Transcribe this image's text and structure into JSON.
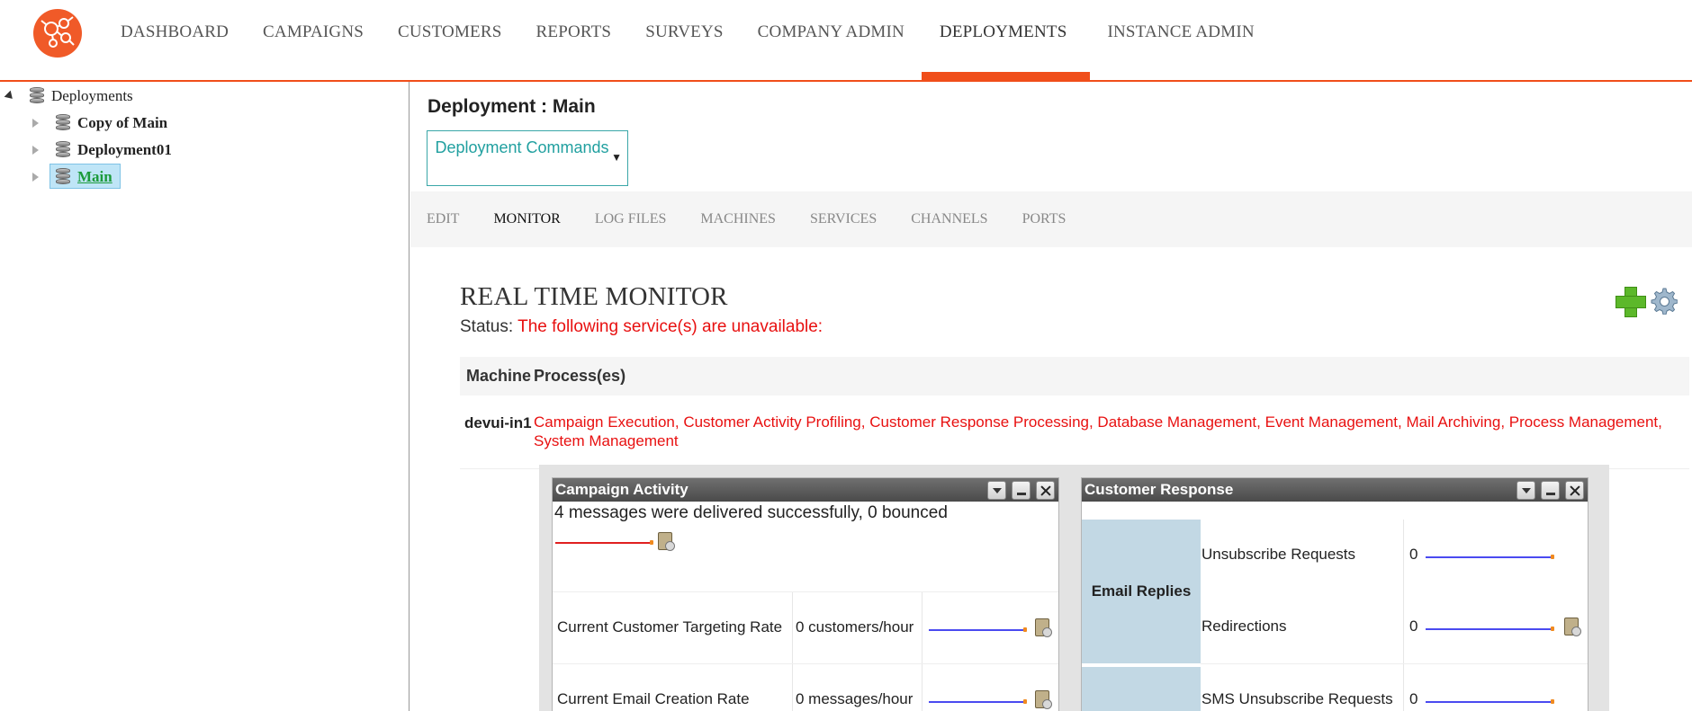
{
  "nav": {
    "items": [
      {
        "label": "DASHBOARD"
      },
      {
        "label": "CAMPAIGNS"
      },
      {
        "label": "CUSTOMERS"
      },
      {
        "label": "REPORTS"
      },
      {
        "label": "SURVEYS"
      },
      {
        "label": "COMPANY ADMIN"
      },
      {
        "label": "DEPLOYMENTS",
        "active": true
      },
      {
        "label": "INSTANCE ADMIN"
      }
    ]
  },
  "tree": {
    "root": "Deployments",
    "children": [
      {
        "label": "Copy of Main"
      },
      {
        "label": "Deployment01"
      },
      {
        "label": "Main",
        "selected": true
      }
    ]
  },
  "main": {
    "title": "Deployment : Main",
    "commands_button": "Deployment Commands",
    "tabs": [
      {
        "label": "EDIT"
      },
      {
        "label": "MONITOR",
        "active": true
      },
      {
        "label": "LOG FILES"
      },
      {
        "label": "MACHINES"
      },
      {
        "label": "SERVICES"
      },
      {
        "label": "CHANNELS"
      },
      {
        "label": "PORTS"
      }
    ],
    "monitor_title": "REAL TIME MONITOR",
    "status_label": "Status:",
    "status_text": "The following service(s) are unavailable:",
    "process_table": {
      "headers": [
        "Machine",
        "Process(es)"
      ],
      "rows": [
        {
          "machine": "devui-in1",
          "processes": "Campaign Execution, Customer Activity Profiling, Customer Response Processing, Database Management, Event Management, Mail Archiving, Process Management, System Management"
        }
      ]
    }
  },
  "widgets": {
    "campaign_activity": {
      "title": "Campaign Activity",
      "message": "4 messages were delivered successfully, 0 bounced",
      "rows": [
        {
          "label": "Current Customer Targeting Rate",
          "value": "0 customers/hour"
        },
        {
          "label": "Current Email Creation Rate",
          "value": "0 messages/hour"
        }
      ]
    },
    "customer_response": {
      "title": "Customer Response",
      "group": "Email Replies",
      "rows": [
        {
          "label": "Unsubscribe Requests",
          "value": "0"
        },
        {
          "label": "Redirections",
          "value": "0"
        },
        {
          "label": "SMS Unsubscribe Requests",
          "value": "0"
        }
      ]
    }
  },
  "colors": {
    "accent": "#f04e1a",
    "teal": "#21a0a0",
    "error": "#e81010",
    "selected_node": "#1b9a3a"
  }
}
